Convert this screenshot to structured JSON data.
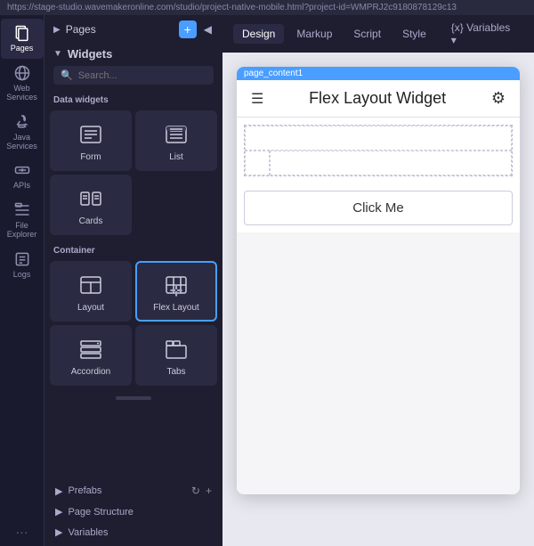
{
  "url_bar": {
    "text": "https://stage-studio.wavemakeronline.com/studio/project-native-mobile.html?project-id=WMPRJ2c9180878129c13"
  },
  "sidebar": {
    "items": [
      {
        "id": "pages",
        "label": "Pages",
        "active": true
      },
      {
        "id": "web-services",
        "label": "Web Services",
        "active": false
      },
      {
        "id": "java-services",
        "label": "Java Services",
        "active": false
      },
      {
        "id": "apis",
        "label": "APIs",
        "active": false
      },
      {
        "id": "file-explorer",
        "label": "File Explorer",
        "active": false
      },
      {
        "id": "logs",
        "label": "Logs",
        "active": false
      }
    ],
    "more_label": "···"
  },
  "panel": {
    "pages_label": "Pages",
    "add_btn_label": "+",
    "collapse_btn_label": "◀",
    "widgets_label": "Widgets",
    "search_placeholder": "Search...",
    "data_widgets_label": "Data widgets",
    "widgets": [
      {
        "id": "form",
        "label": "Form"
      },
      {
        "id": "list",
        "label": "List"
      },
      {
        "id": "cards",
        "label": "Cards"
      }
    ],
    "container_label": "Container",
    "containers": [
      {
        "id": "layout",
        "label": "Layout"
      },
      {
        "id": "flex-layout",
        "label": "Flex Layout",
        "drag_active": true
      },
      {
        "id": "accordion",
        "label": "Accordion"
      },
      {
        "id": "tabs",
        "label": "Tabs"
      }
    ],
    "prefabs_label": "Prefabs",
    "page_structure_label": "Page Structure",
    "variables_label": "Variables"
  },
  "toolbar": {
    "tabs": [
      {
        "id": "design",
        "label": "Design",
        "active": true
      },
      {
        "id": "markup",
        "label": "Markup",
        "active": false
      },
      {
        "id": "script",
        "label": "Script",
        "active": false
      },
      {
        "id": "style",
        "label": "Style",
        "active": false
      },
      {
        "id": "variables",
        "label": "{x} Variables ▾",
        "active": false
      }
    ]
  },
  "phone": {
    "page_content_label": "page_content1",
    "title": "Flex Layout Widget",
    "click_me_label": "Click Me"
  }
}
